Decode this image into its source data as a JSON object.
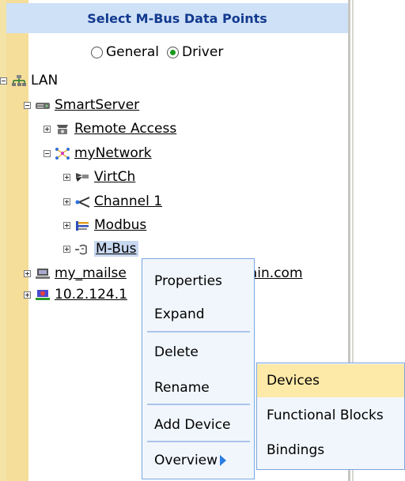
{
  "header": {
    "title": "Select M-Bus Data Points"
  },
  "radios": [
    {
      "label": "General",
      "selected": false
    },
    {
      "label": "Driver",
      "selected": true
    }
  ],
  "tree": {
    "lan": "LAN",
    "smartserver": "SmartServer",
    "remote_access": "Remote Access",
    "mynetwork": "myNetwork",
    "virtch": "VirtCh",
    "channel1": "Channel 1",
    "modbus": "Modbus",
    "mbus": "M-Bus",
    "mailserver_prefix": "my_mailse",
    "mailserver_suffix": "ain.com",
    "ip_host": "10.2.124.1"
  },
  "context_menu": {
    "items": [
      "Properties",
      "Expand",
      "Delete",
      "Rename",
      "Add Device",
      "Overview"
    ]
  },
  "submenu": {
    "items": [
      "Devices",
      "Functional Blocks",
      "Bindings"
    ],
    "highlighted": "Devices"
  },
  "colors": {
    "header_bg": "#cfe1f7",
    "header_text": "#133a8f",
    "gutter": "#f5dd9a",
    "menu_bg": "#f1f6fd",
    "menu_border": "#7aa7e0",
    "highlight": "#fde9a8",
    "selection": "#c8d8f0"
  }
}
